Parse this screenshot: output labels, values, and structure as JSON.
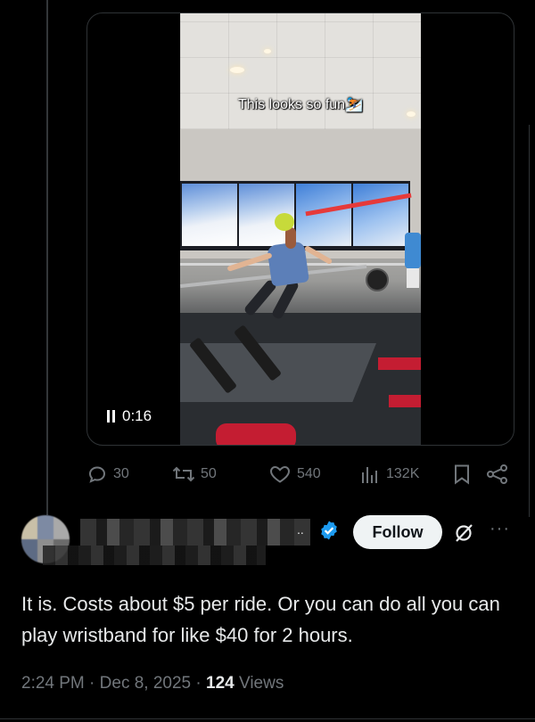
{
  "video": {
    "caption": "This looks so fun",
    "caption_emoji": "⛷️",
    "state": "playing",
    "timestamp": "0:16"
  },
  "actions": {
    "replies": "30",
    "reposts": "50",
    "likes": "540",
    "views": "132K"
  },
  "reply": {
    "author_suffix": "..",
    "follow_label": "Follow",
    "more_label": "···",
    "text": "It is.  Costs about $5 per ride. Or you can do all you can play wristband for like $40 for 2 hours.",
    "time": "2:24 PM",
    "date": "Dec 8, 2025",
    "views_count": "124",
    "views_label": "Views",
    "separator": "·"
  },
  "colors": {
    "background": "#000000",
    "text": "#e7e9ea",
    "muted": "#71767b",
    "verified": "#1d9bf0",
    "follow_bg": "#eff3f4"
  }
}
